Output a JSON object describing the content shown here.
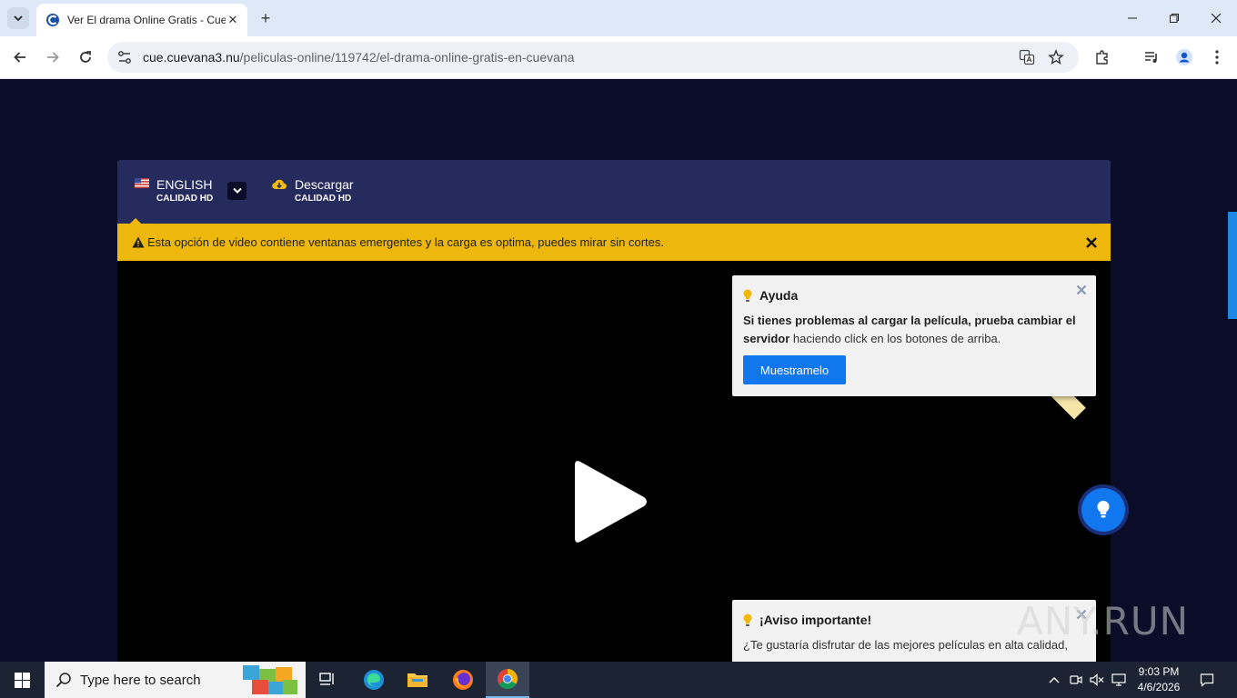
{
  "browser": {
    "tab": {
      "title": "Ver El drama Online Gratis - Cuevana",
      "close_label": "✕"
    },
    "new_tab_label": "+",
    "window": {
      "minimize": "—",
      "maximize": "❐",
      "close": "✕"
    },
    "url": {
      "host": "cue.cuevana3.nu",
      "path": "/peliculas-online/119742/el-drama-online-gratis-en-cuevana"
    },
    "icons": [
      "back-icon",
      "forward-icon",
      "reload-icon",
      "site-info-icon",
      "translate-icon",
      "bookmark-star-icon",
      "extensions-icon",
      "media-control-icon",
      "profile-icon",
      "menu-icon"
    ]
  },
  "player": {
    "servers": [
      {
        "name": "ENGLISH",
        "quality": "CALIDAD HD",
        "icon": "us-flag-icon"
      },
      {
        "name": "Descargar",
        "quality": "CALIDAD HD",
        "icon": "cloud-download-icon"
      }
    ],
    "warning": {
      "text": "Esta opción de video contiene ventanas emergentes y la carga es optima, puedes mirar sin cortes."
    }
  },
  "popups": {
    "help": {
      "title": "Ayuda",
      "body_bold": "Si tienes problemas al cargar la película, prueba cambiar el servidor",
      "body_rest": " haciendo click en los botones de arriba.",
      "button": "Muestramelo"
    },
    "notice": {
      "title": "¡Aviso importante!",
      "body": "¿Te gustaría disfrutar de las mejores películas en alta calidad,"
    }
  },
  "watermark": "ANY.RUN",
  "taskbar": {
    "search_placeholder": "Type here to search",
    "clock": {
      "time": "9:03 PM",
      "date": "4/6/2026"
    }
  },
  "colors": {
    "page_bg": "#0b0d28",
    "server_bar": "#252b5c",
    "warning": "#eeb70d",
    "accent_blue": "#1177ee"
  }
}
